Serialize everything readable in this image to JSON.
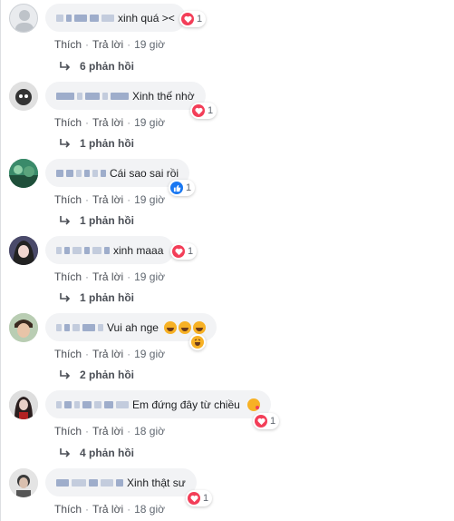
{
  "actions": {
    "like_label": "Thích",
    "reply_label": "Trả lời"
  },
  "comments": [
    {
      "text": "xinh quá ><",
      "reaction_count": "1",
      "reaction_type": "love",
      "time": "19 giờ",
      "replies": "6 phản hồi"
    },
    {
      "text": "Xinh thế nhờ",
      "reaction_count": "1",
      "reaction_type": "love",
      "time": "19 giờ",
      "replies": "1 phản hồi"
    },
    {
      "text": "Cái sao sai rồi",
      "reaction_count": "1",
      "reaction_type": "like",
      "time": "19 giờ",
      "replies": "1 phản hồi"
    },
    {
      "text": "xinh maaa",
      "reaction_count": "1",
      "reaction_type": "love",
      "time": "19 giờ",
      "replies": "1 phản hồi"
    },
    {
      "text": "Vui ah nge",
      "reaction_count": "",
      "reaction_type": "haha",
      "time": "19 giờ",
      "replies": "2 phản hồi"
    },
    {
      "text": "Em đứng đây từ chiều",
      "reaction_count": "1",
      "reaction_type": "love",
      "time": "18 giờ",
      "replies": "4 phản hồi"
    },
    {
      "text": "Xinh thật sư",
      "reaction_count": "1",
      "reaction_type": "love",
      "time": "18 giờ",
      "replies": ""
    }
  ],
  "colors": {
    "love": "#f33e58",
    "like": "#1877f2",
    "haha": "#f7b125",
    "bubble": "#f2f3f5",
    "name_link": "#385898"
  }
}
